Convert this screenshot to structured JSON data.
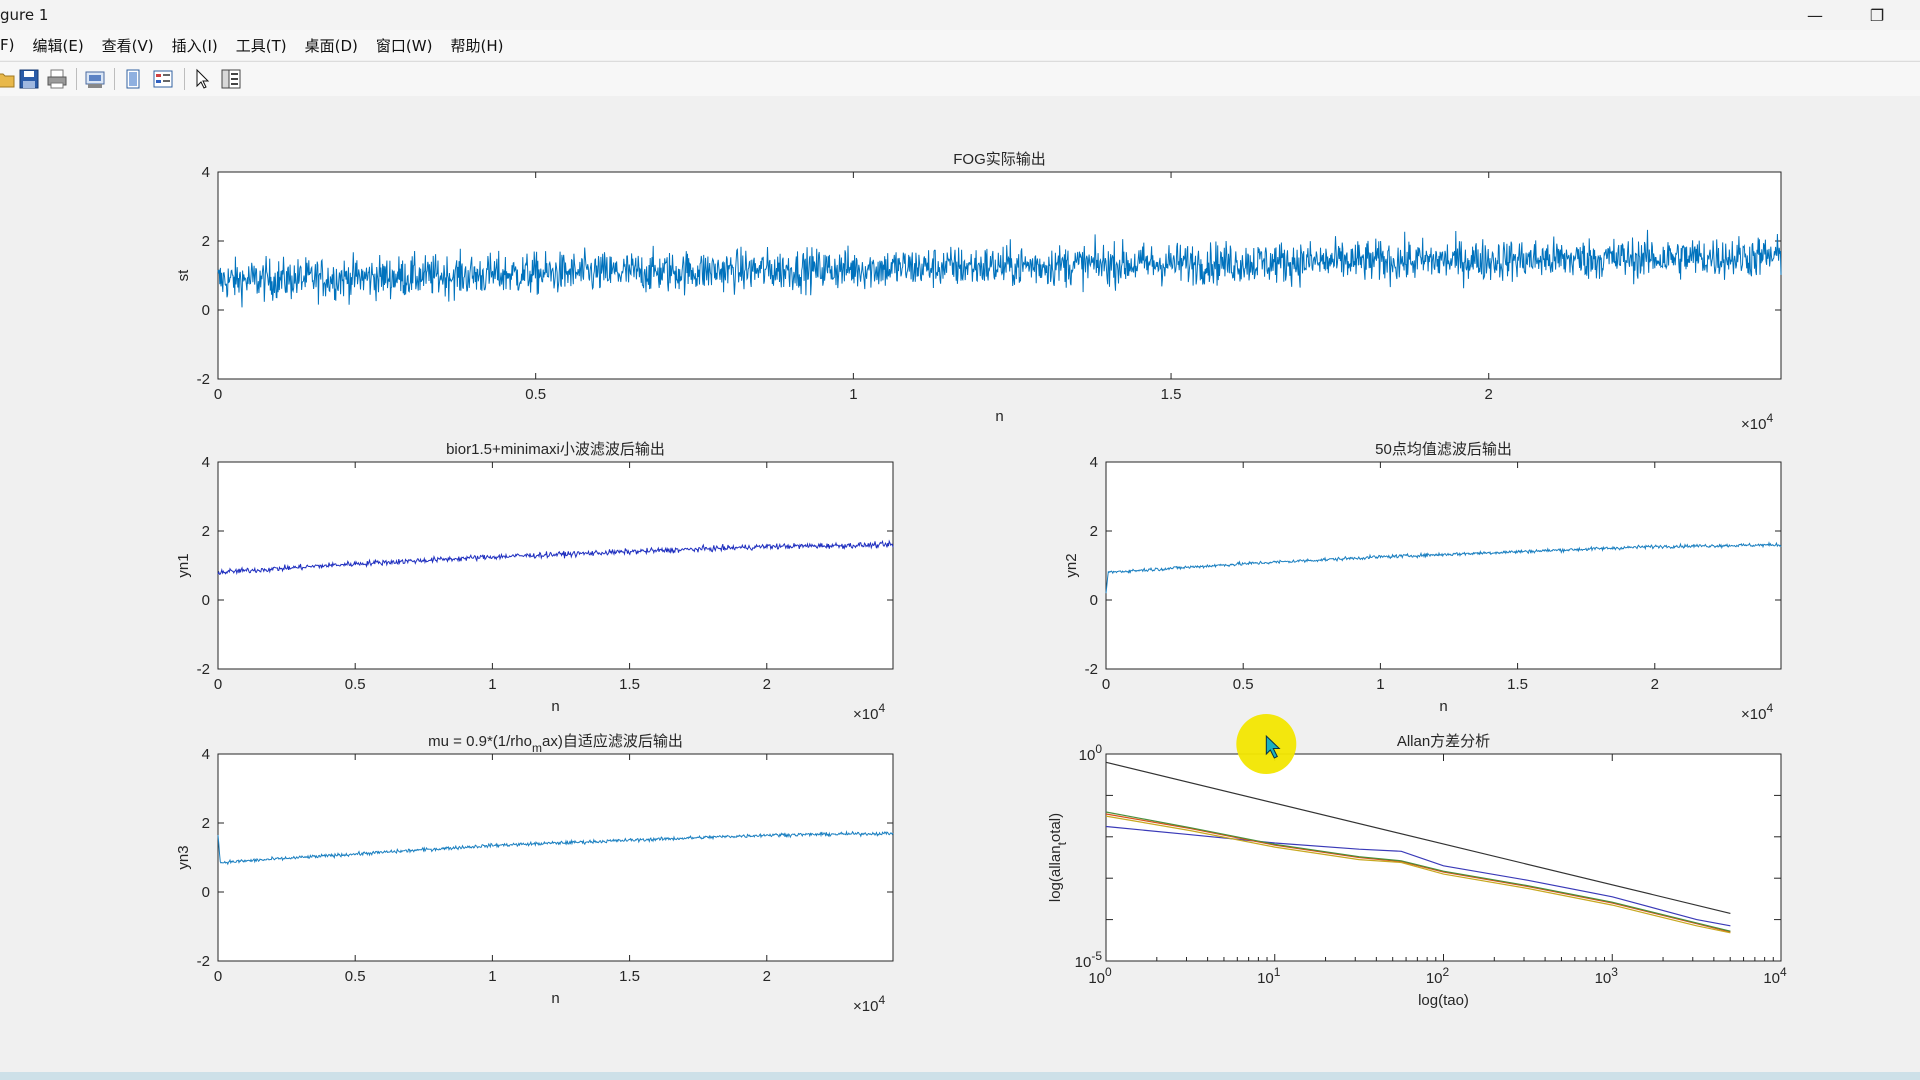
{
  "window": {
    "title": "gure 1",
    "minimize_glyph": "—",
    "restore_glyph": "❐"
  },
  "menu": [
    {
      "label": "F)"
    },
    {
      "label": "编辑(E)"
    },
    {
      "label": "查看(V)"
    },
    {
      "label": "插入(I)"
    },
    {
      "label": "工具(T)"
    },
    {
      "label": "桌面(D)"
    },
    {
      "label": "窗口(W)"
    },
    {
      "label": "帮助(H)"
    }
  ],
  "toolbar": {
    "icons": [
      "open-icon",
      "save-icon",
      "print-icon",
      "print-preview-icon",
      "link-axes-icon",
      "insert-legend-icon",
      "pointer-icon",
      "property-editor-icon"
    ]
  },
  "colors": {
    "fog_line": "#0072BD",
    "yn1_line": "#1f2fbf",
    "yn2_line": "#1a7fc0",
    "yn3_line": "#1a7fc0",
    "allan_black": "#333333",
    "allan_blue": "#3a3ab8",
    "allan_red": "#d95319",
    "allan_yellow": "#c8a820",
    "allan_green": "#4a8f3a",
    "highlight": "#f2e600"
  },
  "chart_data": [
    {
      "id": "fog",
      "type": "line",
      "title": "FOG实际输出",
      "xlabel": "n",
      "ylabel": "st",
      "xlim": [
        0,
        24600
      ],
      "ylim": [
        -2,
        4
      ],
      "x_ticks": [
        "0",
        "0.5",
        "1",
        "1.5",
        "2"
      ],
      "x_tick_values": [
        0,
        5000,
        10000,
        15000,
        20000
      ],
      "y_ticks": [
        "-2",
        "0",
        "2",
        "4"
      ],
      "y_tick_values": [
        -2,
        0,
        2,
        4
      ],
      "exponent_base": "×10",
      "exponent_power": "4",
      "series_trend": {
        "x": [
          0,
          5000,
          10000,
          15000,
          20000,
          24600
        ],
        "mean": [
          0.85,
          1.05,
          1.2,
          1.35,
          1.45,
          1.55
        ],
        "noise_amplitude": 0.6
      }
    },
    {
      "id": "yn1",
      "type": "line",
      "title": "bior1.5+minimaxi小波滤波后输出",
      "xlabel": "n",
      "ylabel": "yn1",
      "xlim": [
        0,
        24600
      ],
      "ylim": [
        -2,
        4
      ],
      "x_ticks": [
        "0",
        "0.5",
        "1",
        "1.5",
        "2"
      ],
      "x_tick_values": [
        0,
        5000,
        10000,
        15000,
        20000
      ],
      "y_ticks": [
        "-2",
        "0",
        "2",
        "4"
      ],
      "y_tick_values": [
        -2,
        0,
        2,
        4
      ],
      "exponent_base": "×10",
      "exponent_power": "4",
      "series_trend": {
        "x": [
          0,
          5000,
          10000,
          15000,
          20000,
          24600
        ],
        "mean": [
          0.8,
          1.05,
          1.25,
          1.4,
          1.55,
          1.6
        ],
        "noise_amplitude": 0.08
      }
    },
    {
      "id": "yn2",
      "type": "line",
      "title": "50点均值滤波后输出",
      "xlabel": "n",
      "ylabel": "yn2",
      "xlim": [
        0,
        24600
      ],
      "ylim": [
        -2,
        4
      ],
      "x_ticks": [
        "0",
        "0.5",
        "1",
        "1.5",
        "2"
      ],
      "x_tick_values": [
        0,
        5000,
        10000,
        15000,
        20000
      ],
      "y_ticks": [
        "-2",
        "0",
        "2",
        "4"
      ],
      "y_tick_values": [
        -2,
        0,
        2,
        4
      ],
      "exponent_base": "×10",
      "exponent_power": "4",
      "series_trend": {
        "x": [
          0,
          5000,
          10000,
          15000,
          20000,
          24600
        ],
        "mean": [
          0.8,
          1.05,
          1.25,
          1.4,
          1.55,
          1.6
        ],
        "noise_amplitude": 0.05
      }
    },
    {
      "id": "yn3",
      "type": "line",
      "title_main": "mu = 0.9*(1/rho",
      "title_sub": "m",
      "title_rest": "ax)自适应滤波后输出",
      "xlabel": "n",
      "ylabel": "yn3",
      "xlim": [
        0,
        24600
      ],
      "ylim": [
        -2,
        4
      ],
      "x_ticks": [
        "0",
        "0.5",
        "1",
        "1.5",
        "2"
      ],
      "x_tick_values": [
        0,
        5000,
        10000,
        15000,
        20000
      ],
      "y_ticks": [
        "-2",
        "0",
        "2",
        "4"
      ],
      "y_tick_values": [
        -2,
        0,
        2,
        4
      ],
      "exponent_base": "×10",
      "exponent_power": "4",
      "series_trend": {
        "x": [
          0,
          5000,
          10000,
          15000,
          20000,
          24600
        ],
        "mean": [
          0.85,
          1.1,
          1.35,
          1.5,
          1.65,
          1.7
        ],
        "noise_amplitude": 0.05
      }
    },
    {
      "id": "allan",
      "type": "line",
      "scale": "loglog",
      "title": "Allan方差分析",
      "xlabel": "log(tao)",
      "ylabel_main": "log(allan",
      "ylabel_sub": "t",
      "ylabel_rest": "otal)",
      "xlim_log10": [
        0,
        4
      ],
      "ylim_log10": [
        -5,
        0
      ],
      "x_tick_exponents": [
        "0",
        "1",
        "2",
        "3",
        "4"
      ],
      "y_tick_exponents": [
        "0",
        "-5"
      ],
      "tick_base": "10",
      "series": [
        {
          "color_key": "allan_black",
          "log10_x": [
            0,
            3.7
          ],
          "log10_y": [
            -0.2,
            -3.85
          ]
        },
        {
          "color_key": "allan_blue",
          "log10_x": [
            0,
            0.5,
            1,
            1.5,
            1.75,
            2,
            2.5,
            3,
            3.5,
            3.7
          ],
          "log10_y": [
            -1.75,
            -1.95,
            -2.15,
            -2.3,
            -2.35,
            -2.7,
            -3.05,
            -3.45,
            -4.0,
            -4.15
          ]
        },
        {
          "color_key": "allan_red",
          "log10_x": [
            0,
            0.5,
            1,
            1.5,
            1.75,
            2,
            2.5,
            3,
            3.5,
            3.7
          ],
          "log10_y": [
            -1.45,
            -1.8,
            -2.2,
            -2.5,
            -2.6,
            -2.85,
            -3.2,
            -3.6,
            -4.1,
            -4.3
          ]
        },
        {
          "color_key": "allan_yellow",
          "log10_x": [
            0,
            0.5,
            1,
            1.5,
            1.75,
            2,
            2.5,
            3,
            3.5,
            3.7
          ],
          "log10_y": [
            -1.5,
            -1.85,
            -2.25,
            -2.55,
            -2.62,
            -2.9,
            -3.25,
            -3.65,
            -4.15,
            -4.32
          ]
        },
        {
          "color_key": "allan_green",
          "log10_x": [
            0,
            0.5,
            1,
            1.5,
            1.75,
            2,
            2.5,
            3,
            3.5,
            3.7
          ],
          "log10_y": [
            -1.4,
            -1.78,
            -2.18,
            -2.48,
            -2.58,
            -2.83,
            -3.18,
            -3.58,
            -4.08,
            -4.28
          ]
        }
      ]
    }
  ]
}
